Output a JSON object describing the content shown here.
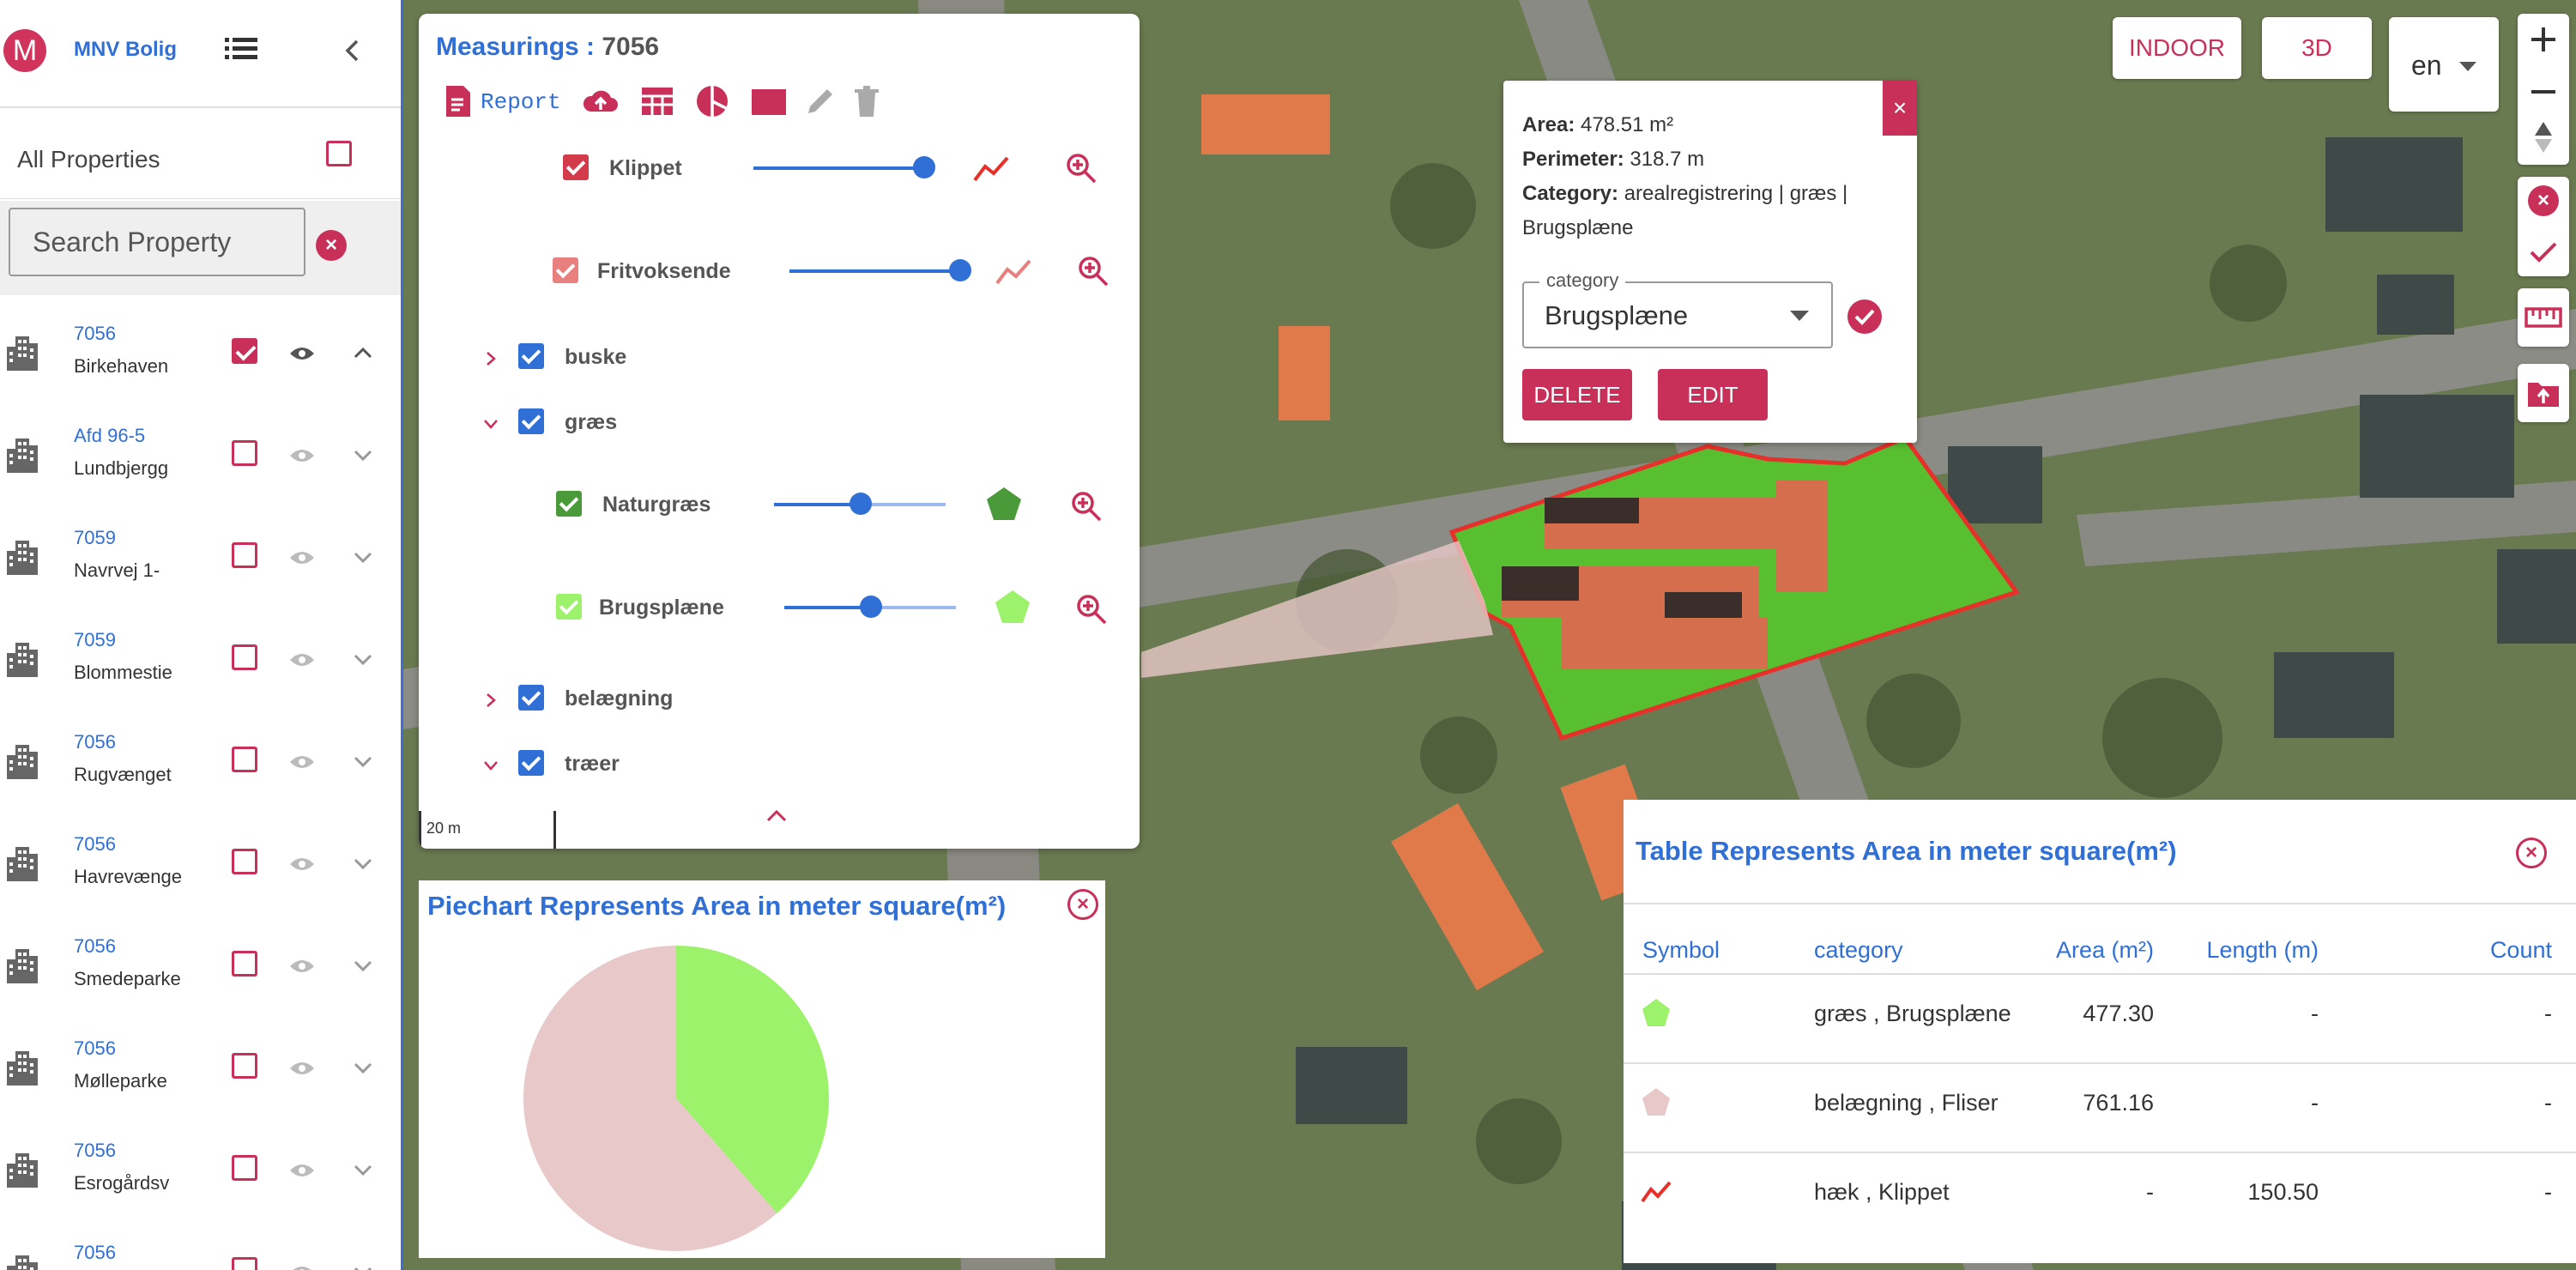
{
  "app": {
    "name": "MNV Bolig",
    "logo_letter": "M"
  },
  "sidebar": {
    "all_properties_label": "All Properties",
    "search_placeholder": "Search Property",
    "properties": [
      {
        "code": "7056",
        "name": "Birkehaven",
        "checked": true,
        "expanded": true
      },
      {
        "code": "Afd 96-5",
        "name": "Lundbjergg",
        "checked": false
      },
      {
        "code": "7059",
        "name": "Navrvej 1-",
        "checked": false
      },
      {
        "code": "7059",
        "name": "Blommestie",
        "checked": false
      },
      {
        "code": "7056",
        "name": "Rugvænget",
        "checked": false
      },
      {
        "code": "7056",
        "name": "Havrevænge",
        "checked": false
      },
      {
        "code": "7056",
        "name": "Smedeparke",
        "checked": false
      },
      {
        "code": "7056",
        "name": "Mølleparke",
        "checked": false
      },
      {
        "code": "7056",
        "name": "Esrogårdsv",
        "checked": false
      },
      {
        "code": "7056",
        "name": "",
        "checked": false
      }
    ]
  },
  "measurings": {
    "title": "Measurings : ",
    "id": "7056",
    "report_label": "Report",
    "layers": {
      "klippet": "Klippet",
      "fritvoksende": "Fritvoksende",
      "buske": "buske",
      "graes": "græs",
      "naturgraes": "Naturgræs",
      "brugsplaene": "Brugsplæne",
      "belaegning": "belægning",
      "traeer": "træer"
    },
    "slider_levels": {
      "klippet": 1.0,
      "fritvoksende": 1.0,
      "naturgraes": 0.5,
      "brugsplaene": 0.5
    },
    "scale_label": "20 m"
  },
  "popup": {
    "area_label": "Area:",
    "area_value": "478.51 m²",
    "perimeter_label": "Perimeter:",
    "perimeter_value": "318.7 m",
    "category_label": "Category:",
    "category_value_1": "arealregistrering | græs |",
    "category_value_2": "Brugsplæne",
    "select_legend": "category",
    "select_value": "Brugsplæne",
    "delete_label": "DELETE",
    "edit_label": "EDIT",
    "close": "×"
  },
  "piechart": {
    "title": "Piechart Represents Area in meter square(m²)",
    "slices": [
      {
        "label": "græs , Brugsplæne",
        "value": 477.3,
        "color": "#9cf26a"
      },
      {
        "label": "belægning , Fliser",
        "value": 761.16,
        "color": "#e8c8c8"
      }
    ]
  },
  "table": {
    "title": "Table Represents Area in meter square(m²)",
    "headers": [
      "Symbol",
      "category",
      "Area (m²)",
      "Length (m)",
      "Count"
    ],
    "rows": [
      {
        "symbol": "pentagon-green",
        "category": "græs , Brugsplæne",
        "area": "477.30",
        "length": "-",
        "count": "-"
      },
      {
        "symbol": "pentagon-pink",
        "category": "belægning , Fliser",
        "area": "761.16",
        "length": "-",
        "count": "-"
      },
      {
        "symbol": "line-red",
        "category": "hæk , Klippet",
        "area": "-",
        "length": "150.50",
        "count": "-"
      }
    ]
  },
  "map_controls": {
    "indoor": "INDOOR",
    "threed": "3D",
    "lang": "en"
  },
  "colors": {
    "accent": "#c8305a",
    "blue": "#2f6fd6",
    "grass": "#9cf26a",
    "pavement": "#e8c8c8",
    "hedge": "#e8302a"
  }
}
